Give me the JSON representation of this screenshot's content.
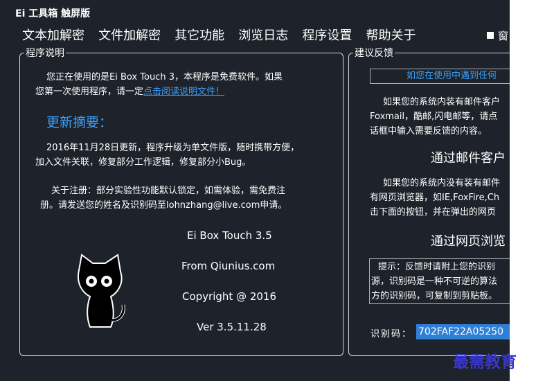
{
  "window": {
    "title": "Ei 工具箱 触屏版"
  },
  "menu": [
    "文本加解密",
    "文件加解密",
    "其它功能",
    "浏览日志",
    "程序设置",
    "帮助关于"
  ],
  "topright_label": "窗",
  "left": {
    "legend": "程序说明",
    "intro_line1": "您正在使用的是Ei Box Touch 3，本程序是免费软件。如果",
    "intro_line2": "您第一次使用程序，请一定",
    "intro_link": "点击阅读说明文件！",
    "update_heading": "更新摘要：",
    "update_line1": "2016年11月28日更新，程序升级为单文件版，随时携带方便，",
    "update_line2": "加入文件关联，修复部分工作逻辑，修复部分小Bug。",
    "reg_line1": "关于注册：部分实验性功能默认锁定，如需体验，需免费注",
    "reg_line2": "册。请发送您的姓名及识别码至lohnzhang@live.com申请。",
    "app_name": "Ei Box Touch 3.5",
    "from": "From Qiunius.com",
    "copyright": "Copyright @ 2016",
    "version": "Ver 3.5.11.28"
  },
  "right": {
    "legend": "建议反馈",
    "banner": "如您在使用中遇到任何",
    "email_line1": "如果您的系统内装有邮件客户",
    "email_line2": "Foxmail，酷邮,闪电邮等，请点",
    "email_line3": "话框中输入需要反馈的内容。",
    "email_heading": "通过邮件客户",
    "web_line1": "如果您的系统内没有装有邮件",
    "web_line2": "有网页浏览器，如IE,FoxFire,Ch",
    "web_line3": "击下面的按钮，并在弹出的网页",
    "web_heading": "通过网页浏览",
    "tip_line1": "提示：反馈时请附上您的识别",
    "tip_line2": "源，识别码是一种不可逆的算法",
    "tip_line3": "方的识别码，可复制到剪贴板。",
    "id_label": "识别码：",
    "id_value": "702FAF22A05250"
  },
  "watermark": "最需教育",
  "colors": {
    "background": "#1e232b",
    "accent": "#3aa0ff",
    "selection": "#2f7fd8",
    "watermark": "#3a37c9"
  }
}
